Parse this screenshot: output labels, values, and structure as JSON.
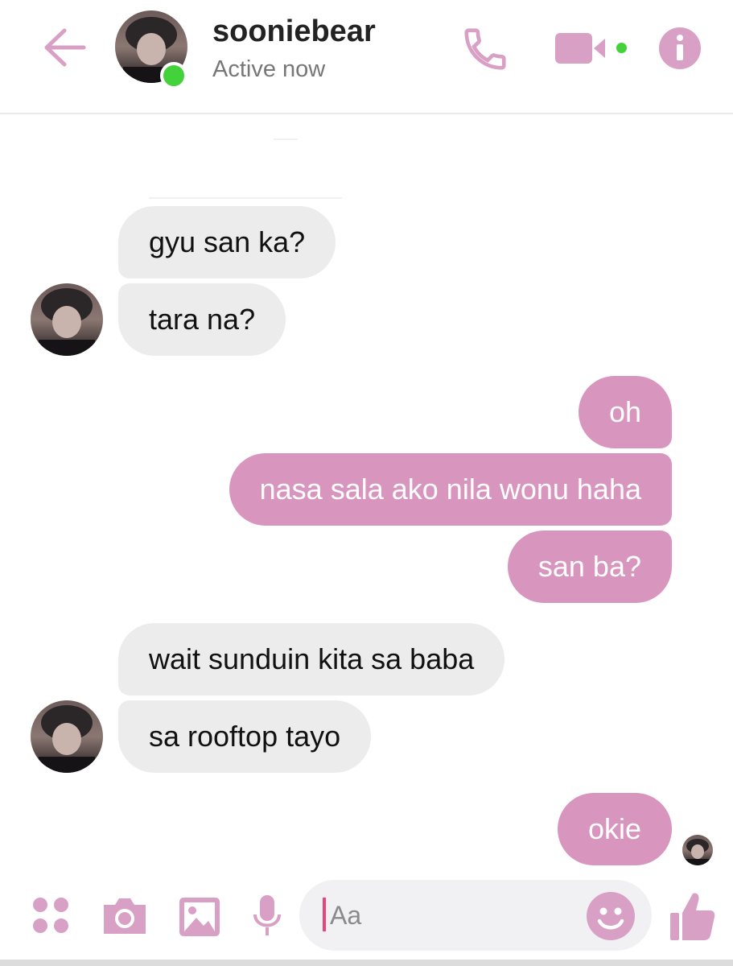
{
  "contact": {
    "name": "sooniebear",
    "status": "Active now"
  },
  "composer": {
    "placeholder": "Aa"
  },
  "messages": [
    {
      "text": "gyu san ka?",
      "from": "them"
    },
    {
      "text": "tara na?",
      "from": "them"
    },
    {
      "text": "oh",
      "from": "me"
    },
    {
      "text": "nasa sala ako nila wonu haha",
      "from": "me"
    },
    {
      "text": "san ba?",
      "from": "me"
    },
    {
      "text": "wait sunduin kita sa baba",
      "from": "them"
    },
    {
      "text": "sa rooftop tayo",
      "from": "them"
    },
    {
      "text": "okie",
      "from": "me"
    }
  ],
  "colors": {
    "accent": "#d896be",
    "incoming_bubble": "#ececec",
    "online": "#44d23b",
    "icon": "#d9a0c5"
  },
  "icons": {
    "header": [
      "back-arrow-icon",
      "phone-icon",
      "video-camera-icon",
      "info-icon"
    ],
    "composer": [
      "more-options-icon",
      "camera-icon",
      "gallery-icon",
      "microphone-icon",
      "emoji-icon",
      "thumbs-up-icon"
    ]
  }
}
